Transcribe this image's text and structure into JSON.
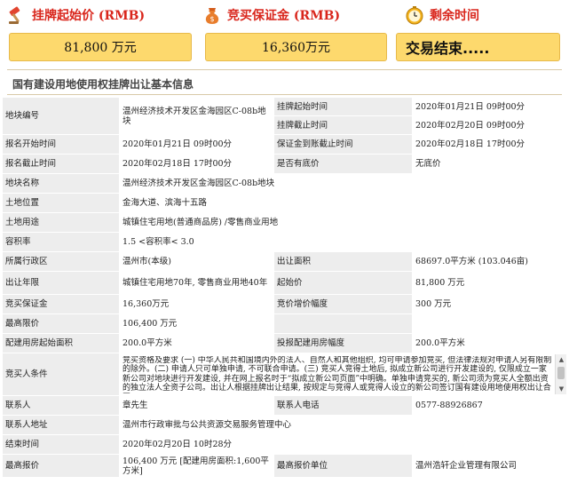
{
  "summary": {
    "start_price": {
      "label": "挂牌起始价 (RMB)",
      "value": "81,800 万元",
      "icon": "hammer-icon"
    },
    "deposit": {
      "label": "竞买保证金 (RMB)",
      "value": "16,360万元",
      "icon": "money-bag-icon"
    },
    "remaining": {
      "label": "剩余时间",
      "value": "交易结束.....",
      "icon": "clock-icon"
    }
  },
  "section_title": "国有建设用地使用权挂牌出让基本信息",
  "table": {
    "r1": {
      "k1": "地块编号",
      "v1": "温州经济技术开发区金海园区C-08b地块",
      "k2a": "挂牌起始时间",
      "v2a": "2020年01月21日 09时00分",
      "k2b": "挂牌截止时间",
      "v2b": "2020年02月20日 09时00分"
    },
    "r2": {
      "k1": "报名开始时间",
      "v1": "2020年01月21日 09时00分",
      "k2": "保证金到账截止时间",
      "v2": "2020年02月18日 17时00分"
    },
    "r3": {
      "k1": "报名截止时间",
      "v1": "2020年02月18日 17时00分",
      "k2": "是否有底价",
      "v2": "无底价"
    },
    "r4": {
      "k": "地块名称",
      "v": "温州经济技术开发区金海园区C-08b地块"
    },
    "r5": {
      "k": "土地位置",
      "v": "金海大道、滨海十五路"
    },
    "r6": {
      "k": "土地用途",
      "v": "城镇住宅用地(普通商品房) /零售商业用地"
    },
    "r7": {
      "k": "容积率",
      "v": "1.5 <容积率< 3.0"
    },
    "r8": {
      "k1": "所属行政区",
      "v1": "温州市(本级)",
      "k2": "出让面积",
      "v2": "68697.0平方米 (103.046亩)"
    },
    "r9": {
      "k1": "出让年限",
      "v1": "城镇住宅用地70年, 零售商业用地40年",
      "k2": "起始价",
      "v2": "81,800 万元"
    },
    "r10": {
      "k1": "竞买保证金",
      "v1": "16,360万元",
      "k2": "竞价增价幅度",
      "v2": "300 万元"
    },
    "r11": {
      "k1": "最高限价",
      "v1": "106,400 万元"
    },
    "r12": {
      "k1": "配建用房起始面积",
      "v1": "200.0平方米",
      "k2": "投报配建用房幅度",
      "v2": "200.0平方米"
    },
    "r13": {
      "k": "竞买人条件",
      "v": "竞买资格及要求 (一) 中华人民共和国境内外的法人、自然人和其他组织, 均可申请参加竞买, 但法律法规对申请人另有限制的除外。(二) 申请人只可单独申请, 不可联合申请。(三) 竞买人竞得土地后, 拟成立新公司进行开发建设的, 仅限成立一家新公司对地块进行开发建设, 并在网上报名时于“拟成立新公司页面”中明确。单独申请竞买的, 新公司须为竞买人全额出资的独立法人全资子公司。出让人根据挂牌出让结果, 按规定与竞得人或竞得人设立的新公司签订国有建设用地使用权出让合同。"
    },
    "r14": {
      "k1": "联系人",
      "v1": "章先生",
      "k2": "联系人电话",
      "v2": "0577-88926867"
    },
    "r15": {
      "k": "联系人地址",
      "v": "温州市行政审批与公共资源交易服务管理中心"
    },
    "r16": {
      "k": "结束时间",
      "v": "2020年02月20日 10时28分"
    },
    "r17": {
      "k1": "最高报价",
      "v1": "106,400 万元 [配建用房面积:1,600平方米]",
      "k2": "最高报价单位",
      "v2": "温州浩轩企业管理有限公司"
    }
  },
  "colors": {
    "accent_red": "#d9261c",
    "summary_box": "#fdd96d",
    "key_cell": "#ededed"
  }
}
